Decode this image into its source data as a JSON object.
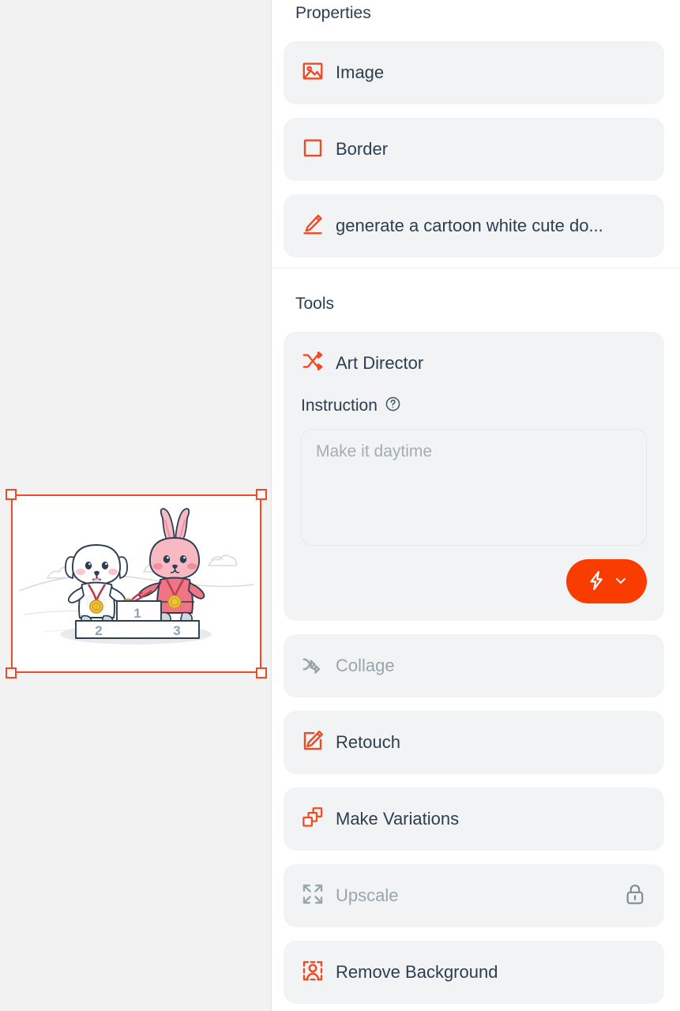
{
  "canvas": {
    "background_color": "#f2f2f2",
    "selection": {
      "color": "#ef4a23",
      "handles": [
        "top-left",
        "top-right",
        "bottom-left",
        "bottom-right"
      ]
    },
    "artwork": {
      "description": "Cartoon white cute dog and pink rabbit with gold medals standing on a winners podium",
      "podium_labels": [
        "2",
        "1",
        "3"
      ]
    }
  },
  "panel": {
    "properties": {
      "title": "Properties",
      "items": [
        {
          "icon": "image-icon",
          "label": "Image",
          "disabled": false
        },
        {
          "icon": "border-icon",
          "label": "Border",
          "disabled": false
        },
        {
          "icon": "pencil-icon",
          "label": "generate a cartoon white cute do...",
          "disabled": false
        }
      ]
    },
    "tools": {
      "title": "Tools",
      "art_director": {
        "icon": "shuffle-icon",
        "title": "Art Director",
        "instruction_label": "Instruction",
        "help_icon": "question-circle-icon",
        "instruction_value": "",
        "instruction_placeholder": "Make it daytime",
        "generate_button": {
          "icon": "lightning-bolt-icon",
          "chevron": "chevron-down-icon",
          "color": "#f93c00",
          "label": ""
        }
      },
      "items": [
        {
          "icon": "collage-icon",
          "label": "Collage",
          "disabled": true,
          "locked": false
        },
        {
          "icon": "retouch-icon",
          "label": "Retouch",
          "disabled": false,
          "locked": false
        },
        {
          "icon": "variations-icon",
          "label": "Make Variations",
          "disabled": false,
          "locked": false
        },
        {
          "icon": "upscale-icon",
          "label": "Upscale",
          "disabled": true,
          "locked": true,
          "lock_icon": "lock-icon"
        },
        {
          "icon": "remove-bg-icon",
          "label": "Remove Background",
          "disabled": false,
          "locked": false
        }
      ]
    }
  },
  "colors": {
    "accent": "#ef4a23",
    "accent_button": "#f93c00",
    "text": "#2c3e50",
    "text_muted": "#9aa5ab",
    "card_bg": "#f1f3f4",
    "canvas_bg": "#f2f2f2"
  }
}
